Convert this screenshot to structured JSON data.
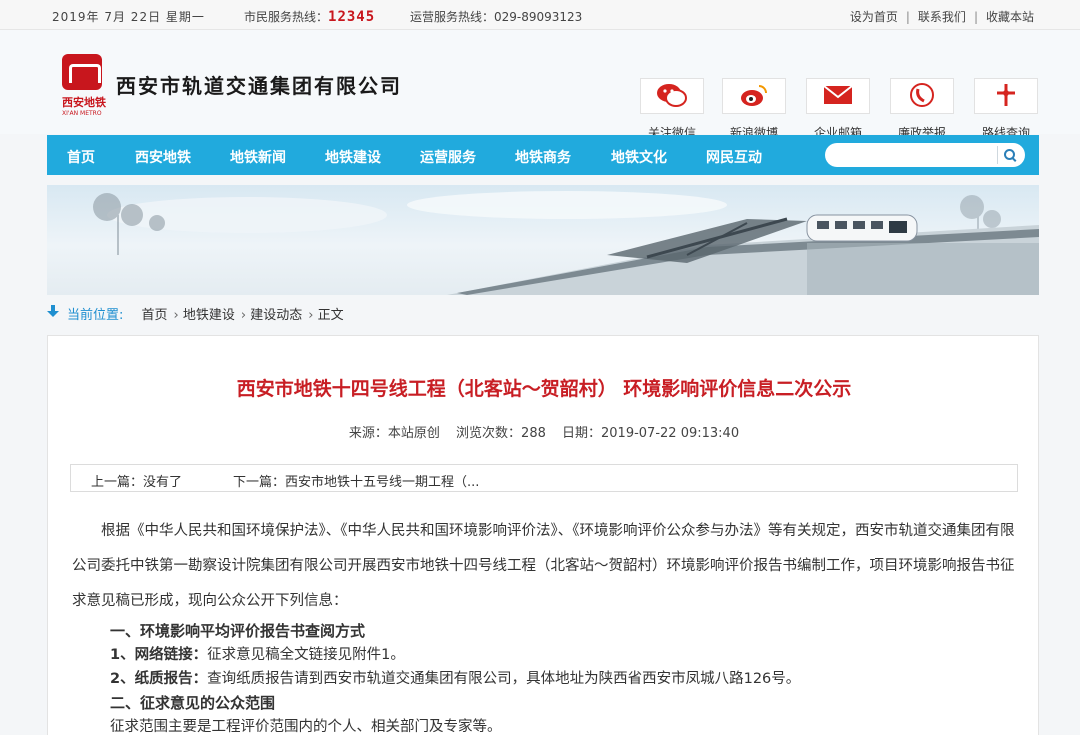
{
  "topbar": {
    "date": "2019年  7月  22日  星期一",
    "hotline_label": "市民服务热线：",
    "hotline_number": "12345",
    "ops_hotline": "运营服务热线：029-89093123",
    "links": [
      "设为首页",
      "联系我们",
      "收藏本站"
    ]
  },
  "logo": {
    "cn": "西安地铁",
    "en": "XI'AN METRO"
  },
  "company_name": "西安市轨道交通集团有限公司",
  "quick_links": [
    {
      "label": "关注微信",
      "icon": "wechat-icon"
    },
    {
      "label": "新浪微博",
      "icon": "weibo-icon"
    },
    {
      "label": "企业邮箱",
      "icon": "mail-icon"
    },
    {
      "label": "廉政举报",
      "icon": "phone-icon"
    },
    {
      "label": "路线查询",
      "icon": "route-icon"
    }
  ],
  "nav": {
    "items": [
      "首页",
      "西安地铁",
      "地铁新闻",
      "地铁建设",
      "运营服务",
      "地铁商务",
      "地铁文化",
      "网民互动"
    ],
    "search_placeholder": ""
  },
  "breadcrumb": {
    "label": "当前位置:",
    "path": [
      "首页",
      "地铁建设",
      "建设动态",
      "正文"
    ]
  },
  "article": {
    "title": "西安市地铁十四号线工程（北客站～贺韶村） 环境影响评价信息二次公示",
    "source": "来源：本站原创",
    "views": "浏览次数：288",
    "date": "日期：2019-07-22 09:13:40",
    "prev": "上一篇：没有了",
    "next": "下一篇：西安市地铁十五号线一期工程（...",
    "para": "根据《中华人民共和国环境保护法》、《中华人民共和国环境影响评价法》、《环境影响评价公众参与办法》等有关规定，西安市轨道交通集团有限公司委托中铁第一勘察设计院集团有限公司开展西安市地铁十四号线工程（北客站～贺韶村）环境影响评价报告书编制工作，项目环境影响报告书征求意见稿已形成，现向公众公开下列信息：",
    "h1": "一、环境影响平均评价报告书查阅方式",
    "l1_label": "1、网络链接：",
    "l1_text": "征求意见稿全文链接见附件1。",
    "l2_label": "2、纸质报告：",
    "l2_text": "查询纸质报告请到西安市轨道交通集团有限公司，具体地址为陕西省西安市凤城八路126号。",
    "h2": "二、征求意见的公众范围",
    "l3_text": "征求范围主要是工程评价范围内的个人、相关部门及专家等。"
  },
  "colors": {
    "nav": "#21aadd",
    "accent_red": "#c81e24",
    "link_blue": "#1f8fd0"
  }
}
